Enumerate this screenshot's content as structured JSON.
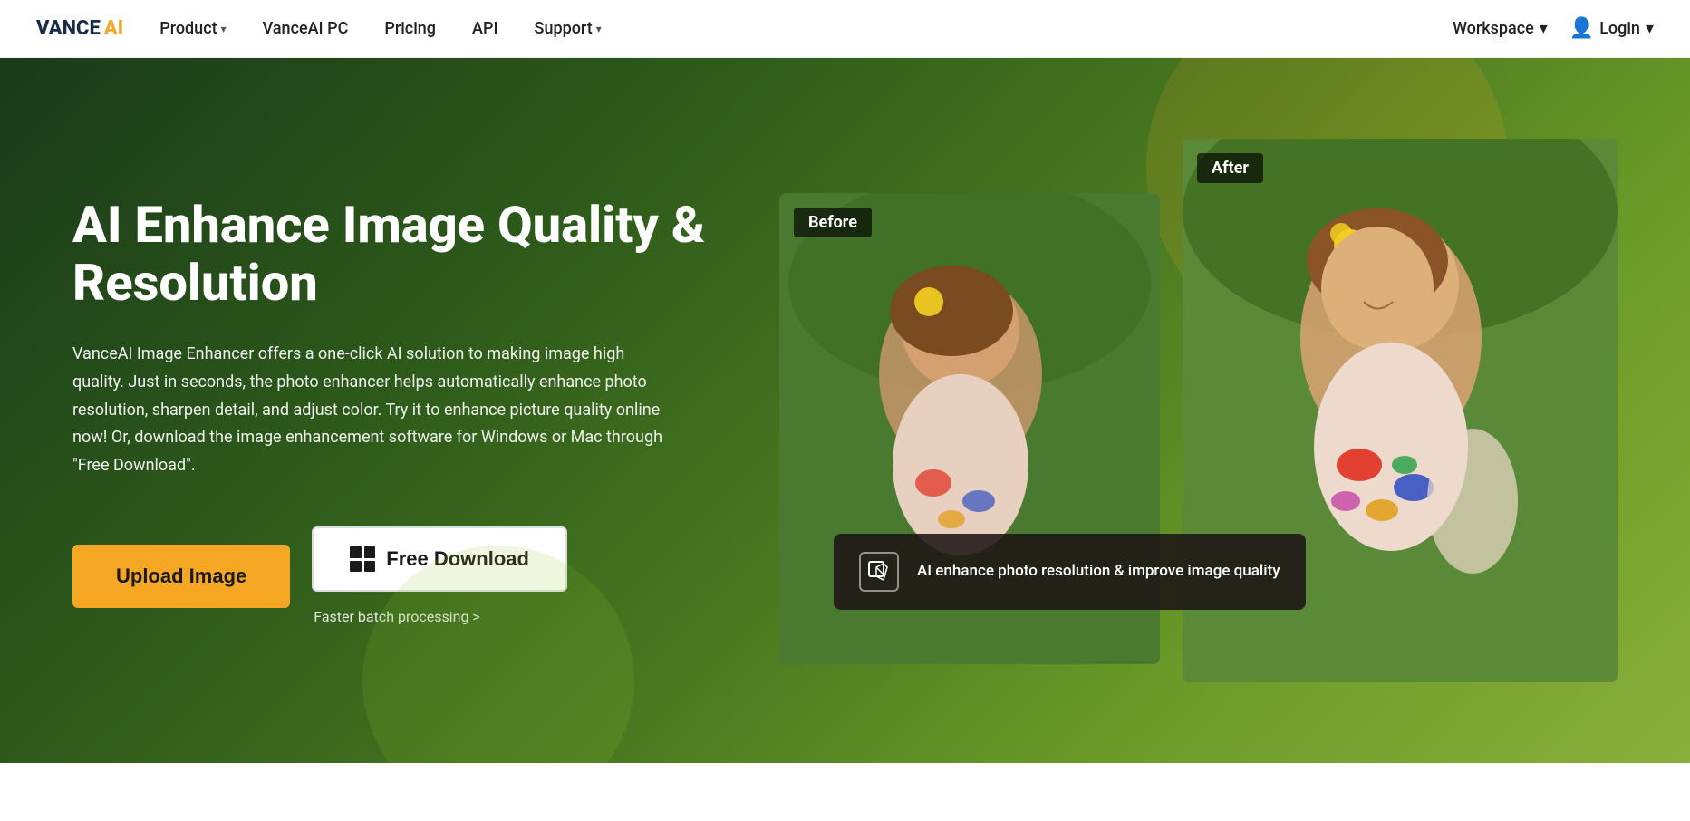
{
  "logo": {
    "vance": "VANCE",
    "ai": "AI"
  },
  "nav": {
    "product": "Product",
    "vanceai_pc": "VanceAI PC",
    "pricing": "Pricing",
    "api": "API",
    "support": "Support",
    "workspace": "Workspace",
    "login": "Login"
  },
  "hero": {
    "title": "AI Enhance Image Quality & Resolution",
    "description": "VanceAI Image Enhancer offers a one-click AI solution to making image high quality. Just in seconds, the photo enhancer helps automatically enhance photo resolution, sharpen detail, and adjust color. Try it to enhance picture quality online now! Or, download the image enhancement software for Windows or Mac through \"Free Download\".",
    "upload_btn": "Upload Image",
    "download_btn": "Free Download",
    "faster_link": "Faster batch processing >",
    "before_label": "Before",
    "after_label": "After",
    "tooltip_text": "AI enhance photo resolution & improve image quality"
  },
  "colors": {
    "accent": "#f5a623",
    "dark_green": "#1a3a1a",
    "white": "#ffffff"
  }
}
